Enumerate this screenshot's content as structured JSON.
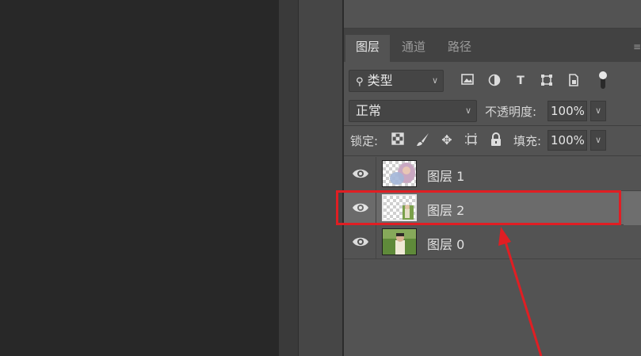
{
  "tabs": [
    {
      "label": "图层"
    },
    {
      "label": "通道"
    },
    {
      "label": "路径"
    }
  ],
  "filter": {
    "label": "类型"
  },
  "blend": {
    "mode": "正常",
    "opacity_label": "不透明度:",
    "opacity_value": "100%"
  },
  "lock": {
    "label": "锁定:",
    "fill_label": "填充:",
    "fill_value": "100%"
  },
  "layers": [
    {
      "name": "图层 1",
      "visible": true,
      "selected": false
    },
    {
      "name": "图层 2",
      "visible": true,
      "selected": true
    },
    {
      "name": "图层 0",
      "visible": true,
      "selected": false
    }
  ],
  "colors": {
    "highlight": "#e01e23",
    "selected_row": "#6b6b6b",
    "panel": "#535353"
  }
}
